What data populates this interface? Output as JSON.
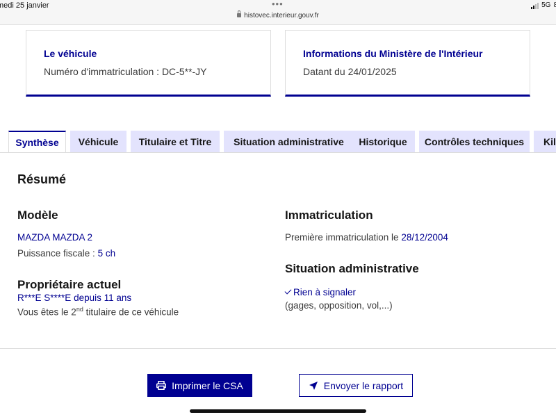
{
  "status_bar": {
    "date": "medi 25 janvier",
    "dots": "•••",
    "url": "histovec.interieur.gouv.fr",
    "network": "5G",
    "battery": "8"
  },
  "cards": {
    "vehicle": {
      "title": "Le véhicule",
      "text": "Numéro d'immatriculation : DC-5**-JY"
    },
    "ministry": {
      "title": "Informations du Ministère de l'Intérieur",
      "text": "Datant du 24/01/2025"
    }
  },
  "tabs": [
    {
      "label": "Synthèse",
      "active": true
    },
    {
      "label": "Véhicule",
      "active": false
    },
    {
      "label": "Titulaire et Titre",
      "active": false
    },
    {
      "label": "Situation administrative",
      "active": false
    },
    {
      "label": "Historique",
      "active": false
    },
    {
      "label": "Contrôles techniques",
      "active": false
    },
    {
      "label": "Kilo",
      "active": false
    }
  ],
  "summary": {
    "heading": "Résumé",
    "model": {
      "heading": "Modèle",
      "name": "MAZDA MAZDA 2",
      "power_label": "Puissance fiscale :",
      "power_value": "5 ch"
    },
    "owner": {
      "heading": "Propriétaire actuel",
      "name": "R***E S****E",
      "since_label": "depuis",
      "since_value": "11 ans",
      "rank_prefix": "Vous êtes le 2",
      "rank_sup": "nd",
      "rank_suffix": "titulaire de ce véhicule"
    },
    "registration": {
      "heading": "Immatriculation",
      "first_label": "Première immatriculation le",
      "first_date": "28/12/2004"
    },
    "admin": {
      "heading": "Situation administrative",
      "status": "Rien à signaler",
      "detail": "(gages, opposition, vol,...)"
    }
  },
  "actions": {
    "print_label": "Imprimer le CSA",
    "send_label": "Envoyer le rapport"
  },
  "colors": {
    "accent": "#000091",
    "tab_bg": "#e3e3fd"
  }
}
